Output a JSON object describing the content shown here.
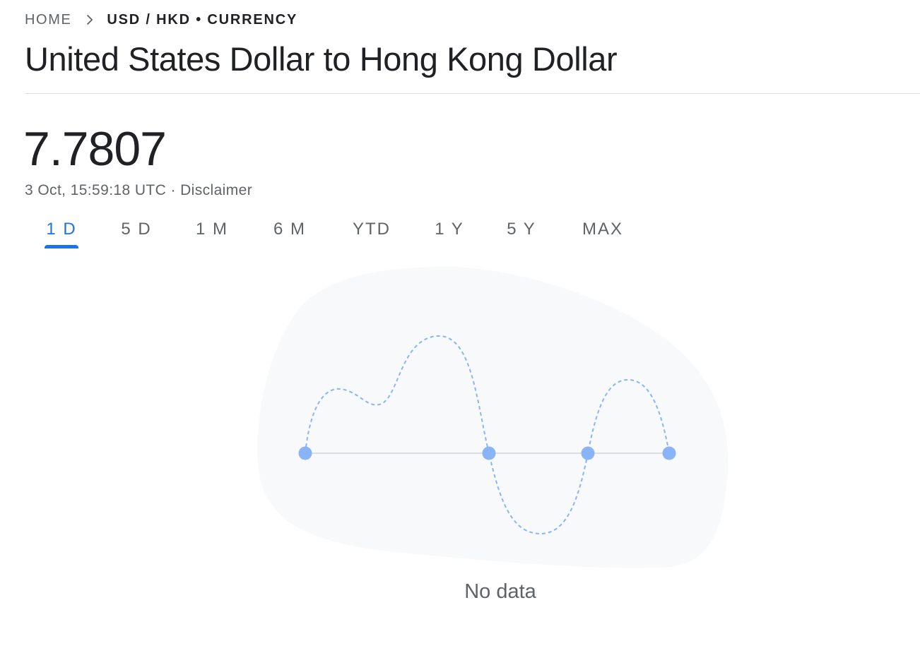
{
  "breadcrumb": {
    "home": "HOME",
    "current": "USD / HKD • CURRENCY"
  },
  "title": "United States Dollar to Hong Kong Dollar",
  "price": "7.7807",
  "meta": {
    "timestamp": "3 Oct, 15:59:18 UTC",
    "separator": " · ",
    "disclaimer": "Disclaimer"
  },
  "tabs": [
    {
      "label": "1 D",
      "active": true
    },
    {
      "label": "5 D",
      "active": false
    },
    {
      "label": "1 M",
      "active": false
    },
    {
      "label": "6 M",
      "active": false
    },
    {
      "label": "YTD",
      "active": false
    },
    {
      "label": "1 Y",
      "active": false
    },
    {
      "label": "5 Y",
      "active": false
    },
    {
      "label": "MAX",
      "active": false
    }
  ],
  "empty_state": {
    "message": "No data"
  },
  "colors": {
    "accent": "#1a73e8",
    "placeholder_blob": "#f8f9fa",
    "placeholder_dots": "#8ab4f8",
    "placeholder_line": "#dadce0"
  },
  "icons": {
    "breadcrumb_separator": "chevron-right-icon"
  }
}
